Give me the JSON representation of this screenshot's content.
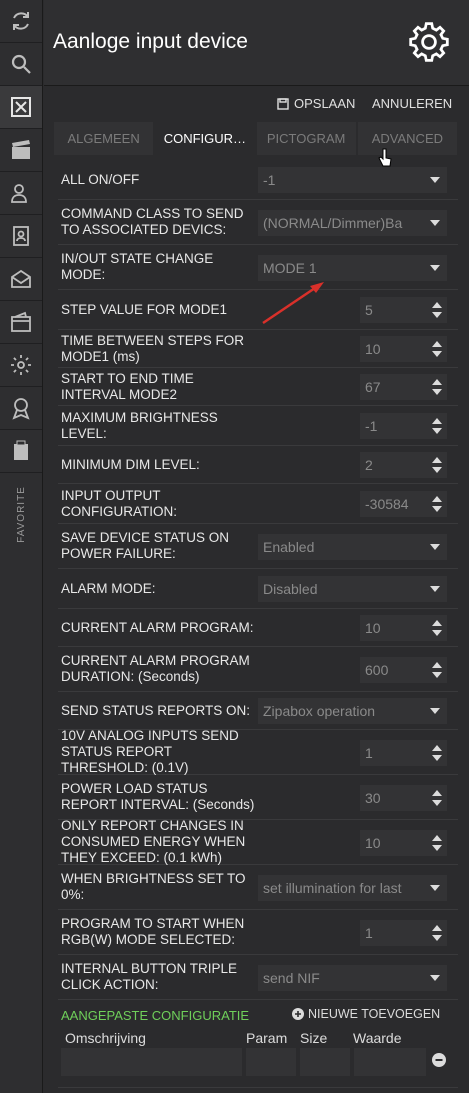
{
  "sidebar": {
    "items": [
      {
        "icon": "refresh-icon"
      },
      {
        "icon": "search-icon"
      },
      {
        "icon": "device-icon"
      },
      {
        "icon": "scene-icon"
      },
      {
        "icon": "users-icon"
      },
      {
        "icon": "contacts-icon"
      },
      {
        "icon": "mail-icon"
      },
      {
        "icon": "wallet-icon"
      },
      {
        "icon": "settings-icon"
      },
      {
        "icon": "award-icon"
      },
      {
        "icon": "clipboard-icon"
      }
    ],
    "favorite_label": "FAVORITE"
  },
  "header": {
    "title": "Aanloge input device"
  },
  "toolbar": {
    "save_label": "OPSLAAN",
    "cancel_label": "ANNULEREN"
  },
  "tabs": [
    {
      "label": "ALGEMEEN",
      "active": false
    },
    {
      "label": "CONFIGUR…",
      "active": true
    },
    {
      "label": "PICTOGRAM",
      "active": false
    },
    {
      "label": "ADVANCED",
      "active": false
    }
  ],
  "fields": [
    {
      "label": "ALL ON/OFF",
      "type": "select",
      "value": "-1"
    },
    {
      "label": "COMMAND CLASS TO SEND TO ASSOCIATED DEVICS:",
      "type": "select",
      "value": "(NORMAL/Dimmer)Ba"
    },
    {
      "label": "IN/OUT STATE CHANGE MODE:",
      "type": "select",
      "value": "MODE 1"
    },
    {
      "label": "STEP VALUE FOR MODE1",
      "type": "number",
      "value": "5"
    },
    {
      "label": "TIME BETWEEN STEPS FOR MODE1 (ms)",
      "type": "number",
      "value": "10"
    },
    {
      "label": "START TO END TIME INTERVAL MODE2",
      "type": "number",
      "value": "67"
    },
    {
      "label": "MAXIMUM BRIGHTNESS LEVEL:",
      "type": "number",
      "value": "-1"
    },
    {
      "label": "MINIMUM DIM LEVEL:",
      "type": "number",
      "value": "2"
    },
    {
      "label": "INPUT OUTPUT CONFIGURATION:",
      "type": "number",
      "value": "-30584"
    },
    {
      "label": "SAVE DEVICE STATUS ON POWER FAILURE:",
      "type": "select",
      "value": "Enabled"
    },
    {
      "label": "ALARM MODE:",
      "type": "select",
      "value": "Disabled"
    },
    {
      "label": "CURRENT ALARM PROGRAM:",
      "type": "number",
      "value": "10"
    },
    {
      "label": "CURRENT ALARM PROGRAM DURATION: (Seconds)",
      "type": "number",
      "value": "600"
    },
    {
      "label": "SEND STATUS REPORTS ON:",
      "type": "select",
      "value": "Zipabox operation"
    },
    {
      "label": "10V ANALOG INPUTS SEND STATUS REPORT THRESHOLD: (0.1V)",
      "type": "number",
      "value": "1"
    },
    {
      "label": "POWER LOAD STATUS REPORT INTERVAL: (Seconds)",
      "type": "number",
      "value": "30"
    },
    {
      "label": "ONLY REPORT CHANGES IN CONSUMED ENERGY WHEN THEY EXCEED: (0.1 kWh)",
      "type": "number",
      "value": "10"
    },
    {
      "label": "WHEN BRIGHTNESS SET TO 0%:",
      "type": "select",
      "value": "set illumination for last"
    },
    {
      "label": "PROGRAM TO START WHEN RGB(W) MODE SELECTED:",
      "type": "number",
      "value": "1"
    },
    {
      "label": "INTERNAL BUTTON TRIPLE CLICK ACTION:",
      "type": "select",
      "value": "send NIF"
    }
  ],
  "custom_config": {
    "title": "AANGEPASTE CONFIGURATIE",
    "new_label": "NIEUWE TOEVOEGEN",
    "columns": [
      "Omschrijving",
      "Param",
      "Size",
      "Waarde"
    ]
  },
  "colors": {
    "accent_green": "#6fcf5a",
    "annotation_arrow": "#d9302a"
  }
}
